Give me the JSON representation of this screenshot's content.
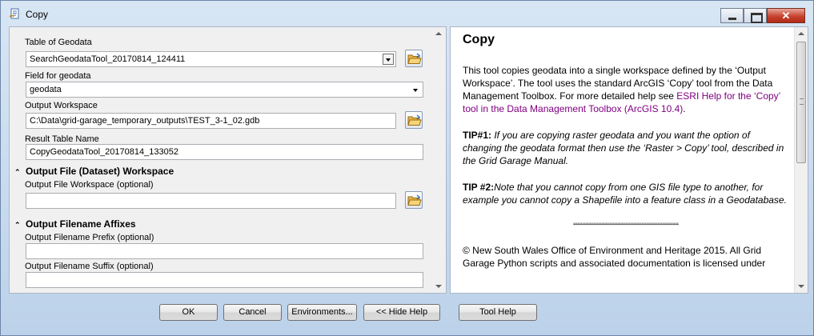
{
  "window": {
    "title": "Copy",
    "icon": "script-tool-icon"
  },
  "form": {
    "table_of_geodata": {
      "label": "Table of Geodata",
      "value": "SearchGeodataTool_20170814_124411"
    },
    "field_for_geodata": {
      "label": "Field for geodata",
      "value": "geodata"
    },
    "output_workspace": {
      "label": "Output Workspace",
      "value": "C:\\Data\\grid-garage_temporary_outputs\\TEST_3-1_02.gdb"
    },
    "result_table_name": {
      "label": "Result Table Name",
      "value": "CopyGeodataTool_20170814_133052"
    },
    "section_output_file": {
      "title": "Output File (Dataset) Workspace"
    },
    "output_file_workspace": {
      "label": "Output File Workspace (optional)",
      "value": ""
    },
    "section_affixes": {
      "title": "Output Filename Affixes"
    },
    "filename_prefix": {
      "label": "Output Filename Prefix (optional)",
      "value": ""
    },
    "filename_suffix": {
      "label": "Output Filename Suffix (optional)",
      "value": ""
    }
  },
  "help": {
    "title": "Copy",
    "para1_pre": "This tool copies geodata into a single workspace defined by the ‘Output Workspace’. The tool uses the standard ArcGIS ‘Copy’ tool from the Data Management Toolbox. For more detailed help see ",
    "para1_link": "ESRI Help for the ‘Copy’ tool in the Data Management Toolbox (ArcGIS 10.4)",
    "para1_post": ".",
    "tip1_label": "TIP#1:",
    "tip1_text": " If you are copying raster geodata and you want the option of changing the geodata format then use the ‘Raster > Copy’ tool, described in the Grid Garage Manual.",
    "tip2_label": "TIP #2:",
    "tip2_text": "Note that you cannot copy from one GIS file type to another, for example you cannot copy a Shapefile into a feature class in a Geodatabase.",
    "divider": "“““““““““““““““““““““““““““““““““",
    "copyright": "© New South Wales Office of Environment and Heritage 2015. All Grid Garage Python scripts and associated documentation is licensed under"
  },
  "buttons": {
    "ok": "OK",
    "cancel": "Cancel",
    "environments": "Environments...",
    "hide_help": "<< Hide Help",
    "tool_help": "Tool Help"
  },
  "colors": {
    "link": "#800080",
    "window_bg": "#c9dbee"
  }
}
